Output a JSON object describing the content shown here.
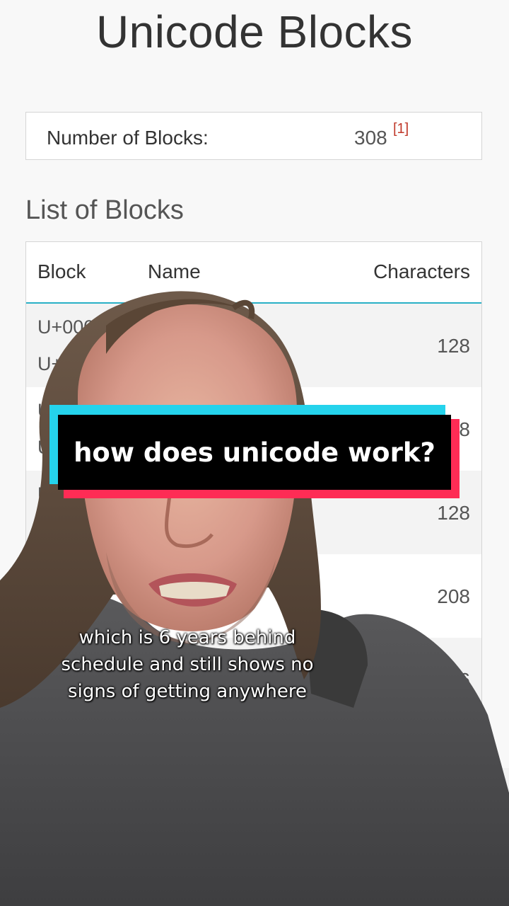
{
  "page": {
    "title": "Unicode Blocks"
  },
  "summary": {
    "label": "Number of Blocks:",
    "value": "308",
    "ref": "[1]"
  },
  "list": {
    "heading": "List of Blocks",
    "columns": {
      "block": "Block",
      "name": "Name",
      "characters": "Characters"
    },
    "rows": [
      {
        "start": "U+0000",
        "end": "U+00",
        "characters": "128"
      },
      {
        "start": "U",
        "end": "U",
        "characters": "8"
      },
      {
        "start": "U+",
        "end": "U+",
        "characters": "128"
      },
      {
        "start": "",
        "end": "",
        "characters": "208"
      },
      {
        "start": "",
        "end": "",
        "characters": "96"
      },
      {
        "start": "",
        "end": "",
        "characters": ""
      }
    ]
  },
  "overlay": {
    "caption": "how does unicode work?",
    "subtitle_lines": [
      "which is 6 years behind",
      "schedule and still shows no",
      "signs of getting anywhere"
    ],
    "colors": {
      "banner_cyan": "#25d3ec",
      "banner_pink": "#fe2c55",
      "banner_black": "#000000",
      "table_accent": "#2ab0c6",
      "ref_red": "#c0392b"
    }
  }
}
